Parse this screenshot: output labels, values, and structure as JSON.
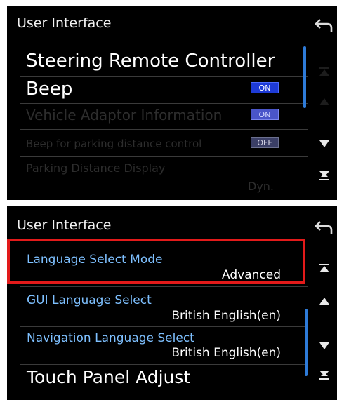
{
  "top_screen": {
    "title": "User Interface",
    "rows": [
      {
        "label": "Steering Remote Controller"
      },
      {
        "label": "Beep",
        "badge": "ON"
      },
      {
        "label": "Vehicle Adaptor Information",
        "badge": "ON"
      },
      {
        "label": "Beep for parking distance control",
        "badge": "OFF"
      },
      {
        "label": "Parking Distance Display",
        "value": "Dyn."
      }
    ],
    "icons": [
      "back-arrow-icon",
      "page-up-icon",
      "scroll-up-icon",
      "scroll-down-icon",
      "page-down-icon"
    ]
  },
  "bottom_screen": {
    "title": "User Interface",
    "rows": [
      {
        "label": "Language Select Mode",
        "value": "Advanced"
      },
      {
        "label": "GUI Language Select",
        "value": "British English(en)"
      },
      {
        "label": "Navigation Language Select",
        "value": "British English(en)"
      },
      {
        "label": "Touch Panel Adjust"
      }
    ],
    "icons": [
      "back-arrow-icon",
      "page-up-icon",
      "scroll-up-icon",
      "scroll-down-icon",
      "page-down-icon"
    ]
  },
  "colors": {
    "background": "#000000",
    "on_badge": "#1e3bd6",
    "label_blue": "#7ec0ff",
    "scrollbar": "#2e7bd8",
    "highlight": "#e21a1a"
  }
}
